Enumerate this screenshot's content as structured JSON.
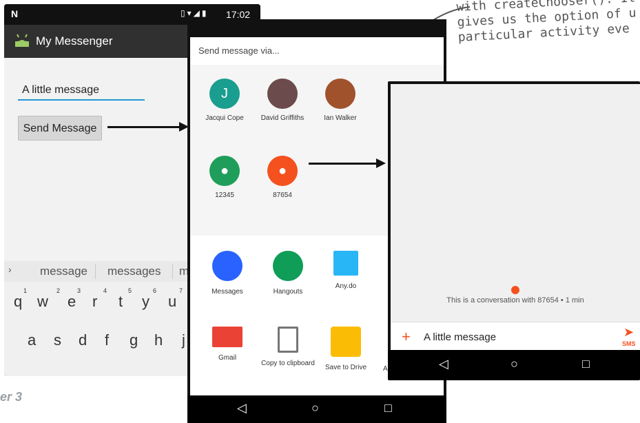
{
  "note": {
    "line1": "with createChooser(). It",
    "line2": "gives us the option of u",
    "line3": "particular activity eve"
  },
  "footer": {
    "text": "er 3"
  },
  "phone1": {
    "status_time": "17:02",
    "app_title": "My Messenger",
    "input_value": "A little message",
    "button_label": "Send Message",
    "suggestions": [
      "message",
      "messages",
      "m"
    ],
    "key_row1": [
      "q",
      "w",
      "e",
      "r",
      "t",
      "y",
      "u"
    ],
    "key_row1_hints": [
      "1",
      "2",
      "3",
      "4",
      "5",
      "6",
      "7"
    ],
    "key_row2": [
      "a",
      "s",
      "d",
      "f",
      "g",
      "h",
      "j"
    ]
  },
  "phone2": {
    "sheet_title": "Send message via...",
    "contacts": [
      {
        "name": "Jacqui Cope",
        "initial": "J",
        "color": "#1a9e8f"
      },
      {
        "name": "David Griffiths",
        "initial": "",
        "color": "#6b4b4b"
      },
      {
        "name": "Ian Walker",
        "initial": "",
        "color": "#a0522d"
      },
      {
        "name": "12345",
        "initial": "",
        "color": "#1e9e5a"
      },
      {
        "name": "87654",
        "initial": "",
        "color": "#f4511e"
      }
    ],
    "apps": [
      {
        "name": "Messages",
        "color": "#2962ff"
      },
      {
        "name": "Hangouts",
        "color": "#0f9d58"
      },
      {
        "name": "Any.do",
        "color": "#29b6f6"
      },
      {
        "name": "Gmail",
        "color": "#ea4335"
      },
      {
        "name": "Copy to clipboard",
        "color": "#757575"
      },
      {
        "name": "Save to Drive",
        "color": "#fbbc05"
      }
    ],
    "partial_app_label": "A"
  },
  "phone3": {
    "conversation_text": "This is a conversation with 87654 • 1 min",
    "message_value": "A little message",
    "send_label": "SMS",
    "accent_color": "#f4511e"
  }
}
